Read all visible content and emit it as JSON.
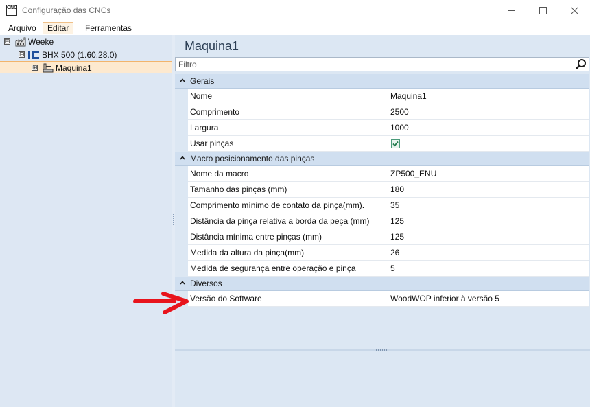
{
  "window": {
    "title": "Configuração das CNCs",
    "app_icon_text": "CNC"
  },
  "menu": {
    "items": [
      {
        "label": "Arquivo",
        "active": false
      },
      {
        "label": "Editar",
        "active": true
      },
      {
        "label": "Ferramentas",
        "active": false
      }
    ]
  },
  "tree": {
    "root": {
      "label": "Weeke",
      "expander": "⊟"
    },
    "child": {
      "label": "BHX 500 (1.60.28.0)",
      "expander": "⊟"
    },
    "leaf": {
      "label": "Maquina1",
      "expander": "⊞",
      "selected": true
    }
  },
  "properties": {
    "heading": "Maquina1",
    "filter_placeholder": "Filtro",
    "categories": [
      {
        "label": "Gerais",
        "rows": [
          {
            "name": "Nome",
            "value": "Maquina1"
          },
          {
            "name": "Comprimento",
            "value": "2500"
          },
          {
            "name": "Largura",
            "value": "1000"
          },
          {
            "name": "Usar pinças",
            "value": "",
            "checked": true
          }
        ]
      },
      {
        "label": "Macro posicionamento das pinças",
        "rows": [
          {
            "name": "Nome da macro",
            "value": "ZP500_ENU"
          },
          {
            "name": "Tamanho das pinças (mm)",
            "value": "180"
          },
          {
            "name": "Comprimento mínimo de contato da pinça(mm).",
            "value": "35"
          },
          {
            "name": "Distância da pinça relativa a borda da peça (mm)",
            "value": "125"
          },
          {
            "name": "Distância mínima entre pinças (mm)",
            "value": "125"
          },
          {
            "name": "Medida da altura da pinça(mm)",
            "value": "26"
          },
          {
            "name": "Medida de segurança entre operação e pinça",
            "value": "5"
          }
        ]
      },
      {
        "label": "Diversos",
        "rows": [
          {
            "name": "Versão do Software",
            "value": "WoodWOP inferior à versão 5"
          }
        ]
      }
    ]
  },
  "colors": {
    "annotation_arrow": "#e8141c",
    "selection_bg": "#fde9cf",
    "panel_bg": "#dce7f3"
  }
}
